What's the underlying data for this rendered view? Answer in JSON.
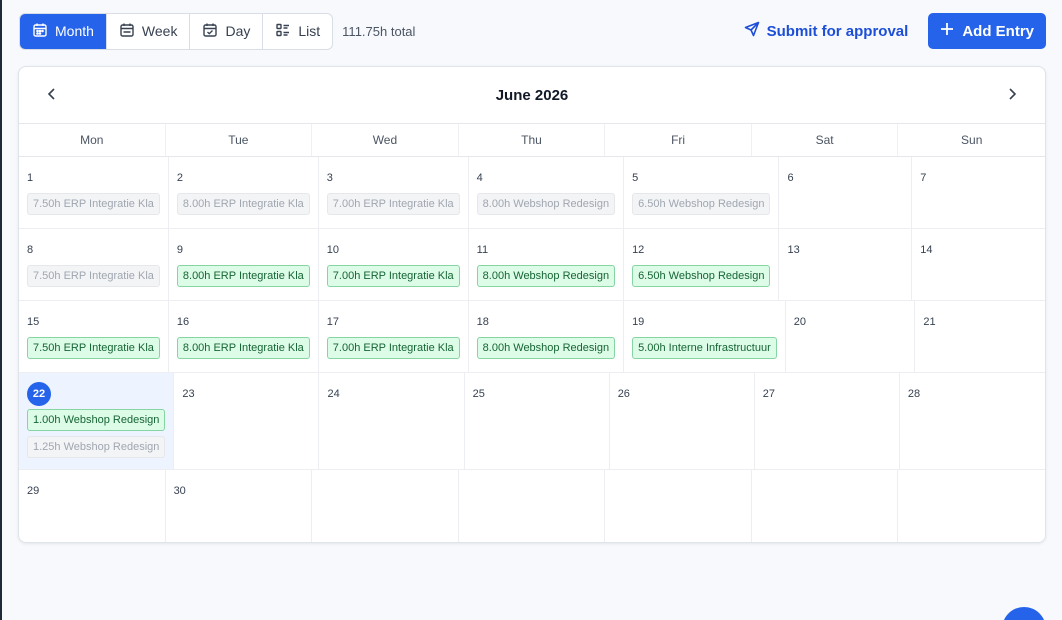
{
  "toolbar": {
    "views": [
      {
        "label": "Month",
        "icon": "calendar-month-icon",
        "active": true
      },
      {
        "label": "Week",
        "icon": "calendar-week-icon",
        "active": false
      },
      {
        "label": "Day",
        "icon": "calendar-check-icon",
        "active": false
      },
      {
        "label": "List",
        "icon": "list-icon",
        "active": false
      }
    ],
    "total": "111.75h total",
    "submit_label": "Submit for approval",
    "add_label": "Add Entry"
  },
  "calendar": {
    "title": "June 2026",
    "weekdays": [
      "Mon",
      "Tue",
      "Wed",
      "Thu",
      "Fri",
      "Sat",
      "Sun"
    ],
    "weeks": [
      [
        {
          "day": "1",
          "entries": [
            {
              "text": "7.50h ERP Integratie Kla",
              "status": "gray"
            }
          ]
        },
        {
          "day": "2",
          "entries": [
            {
              "text": "8.00h ERP Integratie Kla",
              "status": "gray"
            }
          ]
        },
        {
          "day": "3",
          "entries": [
            {
              "text": "7.00h ERP Integratie Kla",
              "status": "gray"
            }
          ]
        },
        {
          "day": "4",
          "entries": [
            {
              "text": "8.00h Webshop Redesign",
              "status": "gray"
            }
          ]
        },
        {
          "day": "5",
          "entries": [
            {
              "text": "6.50h Webshop Redesign",
              "status": "gray"
            }
          ]
        },
        {
          "day": "6",
          "entries": []
        },
        {
          "day": "7",
          "entries": []
        }
      ],
      [
        {
          "day": "8",
          "entries": [
            {
              "text": "7.50h ERP Integratie Kla",
              "status": "gray"
            }
          ]
        },
        {
          "day": "9",
          "entries": [
            {
              "text": "8.00h ERP Integratie Kla",
              "status": "green"
            }
          ]
        },
        {
          "day": "10",
          "entries": [
            {
              "text": "7.00h ERP Integratie Kla",
              "status": "green"
            }
          ]
        },
        {
          "day": "11",
          "entries": [
            {
              "text": "8.00h Webshop Redesign",
              "status": "green"
            }
          ]
        },
        {
          "day": "12",
          "entries": [
            {
              "text": "6.50h Webshop Redesign",
              "status": "green"
            }
          ]
        },
        {
          "day": "13",
          "entries": []
        },
        {
          "day": "14",
          "entries": []
        }
      ],
      [
        {
          "day": "15",
          "entries": [
            {
              "text": "7.50h ERP Integratie Kla",
              "status": "green"
            }
          ]
        },
        {
          "day": "16",
          "entries": [
            {
              "text": "8.00h ERP Integratie Kla",
              "status": "green"
            }
          ]
        },
        {
          "day": "17",
          "entries": [
            {
              "text": "7.00h ERP Integratie Kla",
              "status": "green"
            }
          ]
        },
        {
          "day": "18",
          "entries": [
            {
              "text": "8.00h Webshop Redesign",
              "status": "green"
            }
          ]
        },
        {
          "day": "19",
          "entries": [
            {
              "text": "5.00h Interne Infrastructuur",
              "status": "green"
            }
          ]
        },
        {
          "day": "20",
          "entries": []
        },
        {
          "day": "21",
          "entries": []
        }
      ],
      [
        {
          "day": "22",
          "today": true,
          "entries": [
            {
              "text": "1.00h Webshop Redesign",
              "status": "green"
            },
            {
              "text": "1.25h Webshop Redesign",
              "status": "gray"
            }
          ]
        },
        {
          "day": "23",
          "entries": []
        },
        {
          "day": "24",
          "entries": []
        },
        {
          "day": "25",
          "entries": []
        },
        {
          "day": "26",
          "entries": []
        },
        {
          "day": "27",
          "entries": []
        },
        {
          "day": "28",
          "entries": []
        }
      ],
      [
        {
          "day": "29",
          "entries": []
        },
        {
          "day": "30",
          "entries": []
        },
        {
          "day": "",
          "entries": []
        },
        {
          "day": "",
          "entries": []
        },
        {
          "day": "",
          "entries": []
        },
        {
          "day": "",
          "entries": []
        },
        {
          "day": "",
          "entries": []
        }
      ]
    ]
  },
  "colors": {
    "accent": "#2563eb",
    "approved_bg": "#dcfce7",
    "approved_border": "#86d4a1",
    "pending_bg": "#f3f4f6",
    "today_bg": "#eef4ff"
  }
}
